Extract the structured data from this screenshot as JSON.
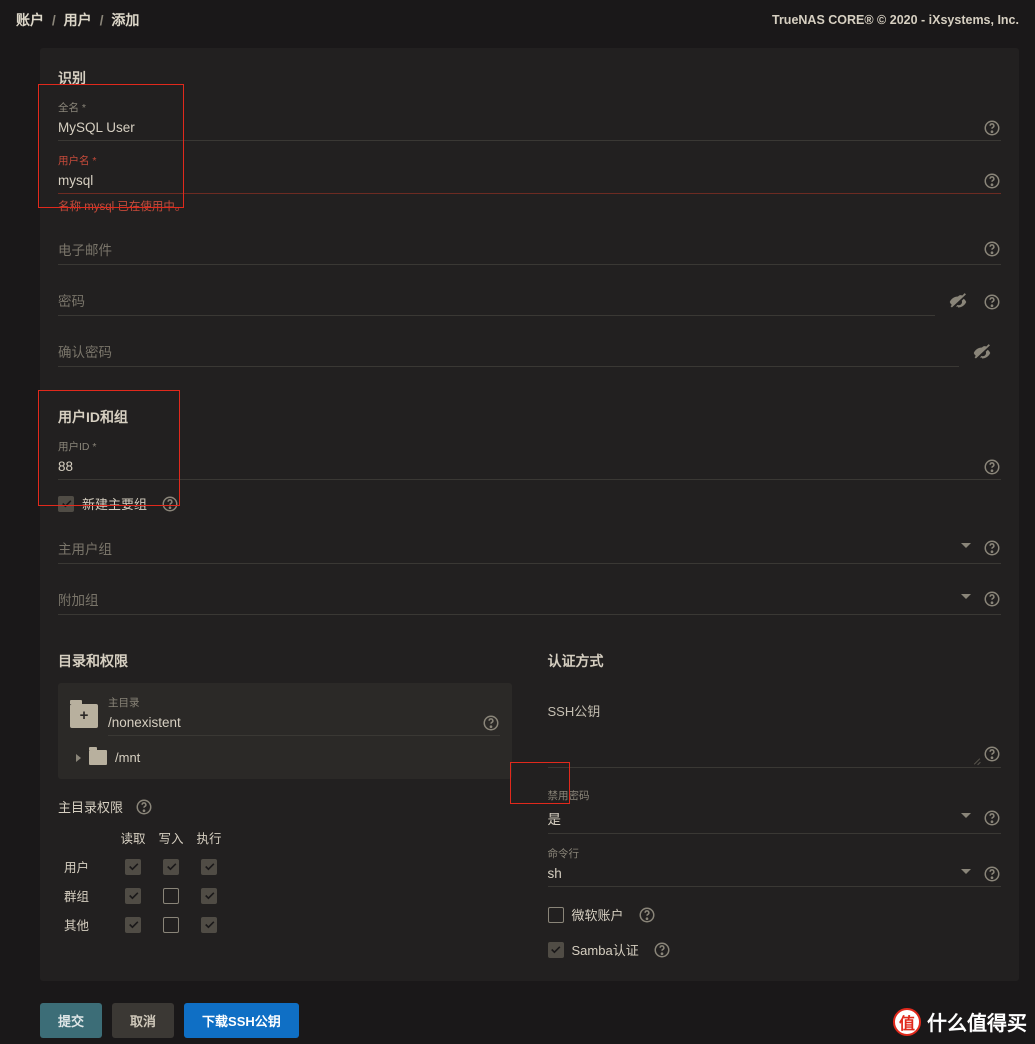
{
  "breadcrumb": {
    "a": "账户",
    "b": "用户",
    "c": "添加"
  },
  "copyright": "TrueNAS CORE® © 2020 - iXsystems, Inc.",
  "identify": {
    "title": "识别",
    "fullname_label": "全名 *",
    "fullname_value": "MySQL User",
    "username_label": "用户名 *",
    "username_value": "mysql",
    "username_error": "名称 mysql 已在使用中。",
    "email_label": "电子邮件",
    "email_value": "",
    "password_label": "密码",
    "confirm_label": "确认密码"
  },
  "idgroup": {
    "title": "用户ID和组",
    "uid_label": "用户ID *",
    "uid_value": "88",
    "new_primary_label": "新建主要组",
    "primary_group_label": "主用户组",
    "aux_group_label": "附加组"
  },
  "dirperm": {
    "title": "目录和权限",
    "home_label": "主目录",
    "home_value": "/nonexistent",
    "mnt_label": "/mnt",
    "perm_title": "主目录权限",
    "headers": {
      "read": "读取",
      "write": "写入",
      "exec": "执行"
    },
    "rows": {
      "user": "用户",
      "group": "群组",
      "other": "其他"
    },
    "matrix": {
      "user": {
        "read": true,
        "write": true,
        "exec": true
      },
      "group": {
        "read": true,
        "write": false,
        "exec": true
      },
      "other": {
        "read": true,
        "write": false,
        "exec": true
      }
    }
  },
  "auth": {
    "title": "认证方式",
    "ssh_label": "SSH公钥",
    "disable_pw_label": "禁用密码",
    "disable_pw_value": "是",
    "shell_label": "命令行",
    "shell_value": "sh",
    "ms_account_label": "微软账户",
    "samba_label": "Samba认证"
  },
  "buttons": {
    "submit": "提交",
    "cancel": "取消",
    "download_ssh": "下载SSH公钥"
  },
  "watermark": "什么值得买"
}
